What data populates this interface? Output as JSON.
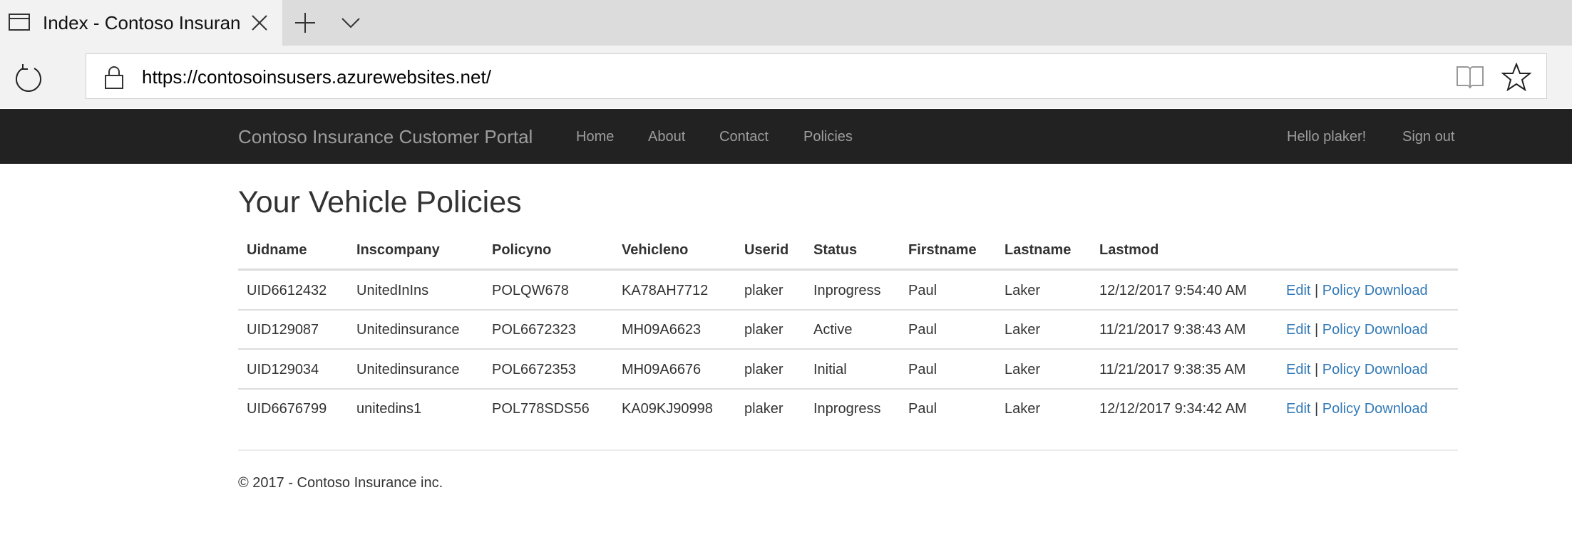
{
  "browser": {
    "tab_title": "Index - Contoso Insurance Customer Portal",
    "url": "https://contosoinsusers.azurewebsites.net/"
  },
  "nav": {
    "brand": "Contoso Insurance Customer Portal",
    "home": "Home",
    "about": "About",
    "contact": "Contact",
    "policies": "Policies",
    "greeting": "Hello plaker!",
    "sign_out": "Sign out"
  },
  "page": {
    "title": "Your Vehicle Policies"
  },
  "table": {
    "headers": [
      "Uidname",
      "Inscompany",
      "Policyno",
      "Vehicleno",
      "Userid",
      "Status",
      "Firstname",
      "Lastname",
      "Lastmod"
    ],
    "edit_label": "Edit",
    "separator": "|",
    "download_label": "Policy Download",
    "rows": [
      [
        "UID6612432",
        "UnitedInIns",
        "POLQW678",
        "KA78AH7712",
        "plaker",
        "Inprogress",
        "Paul",
        "Laker",
        "12/12/2017 9:54:40 AM"
      ],
      [
        "UID129087",
        "Unitedinsurance",
        "POL6672323",
        "MH09A6623",
        "plaker",
        "Active",
        "Paul",
        "Laker",
        "11/21/2017 9:38:43 AM"
      ],
      [
        "UID129034",
        "Unitedinsurance",
        "POL6672353",
        "MH09A6676",
        "plaker",
        "Initial",
        "Paul",
        "Laker",
        "11/21/2017 9:38:35 AM"
      ],
      [
        "UID6676799",
        "unitedins1",
        "POL778SDS56",
        "KA09KJ90998",
        "plaker",
        "Inprogress",
        "Paul",
        "Laker",
        "12/12/2017 9:34:42 AM"
      ]
    ]
  },
  "footer": {
    "text": "© 2017 - Contoso Insurance inc."
  },
  "colors": {
    "navbar_bg": "#222222",
    "nav_text": "#9d9d9d",
    "link": "#337ab7",
    "text": "#333333"
  }
}
